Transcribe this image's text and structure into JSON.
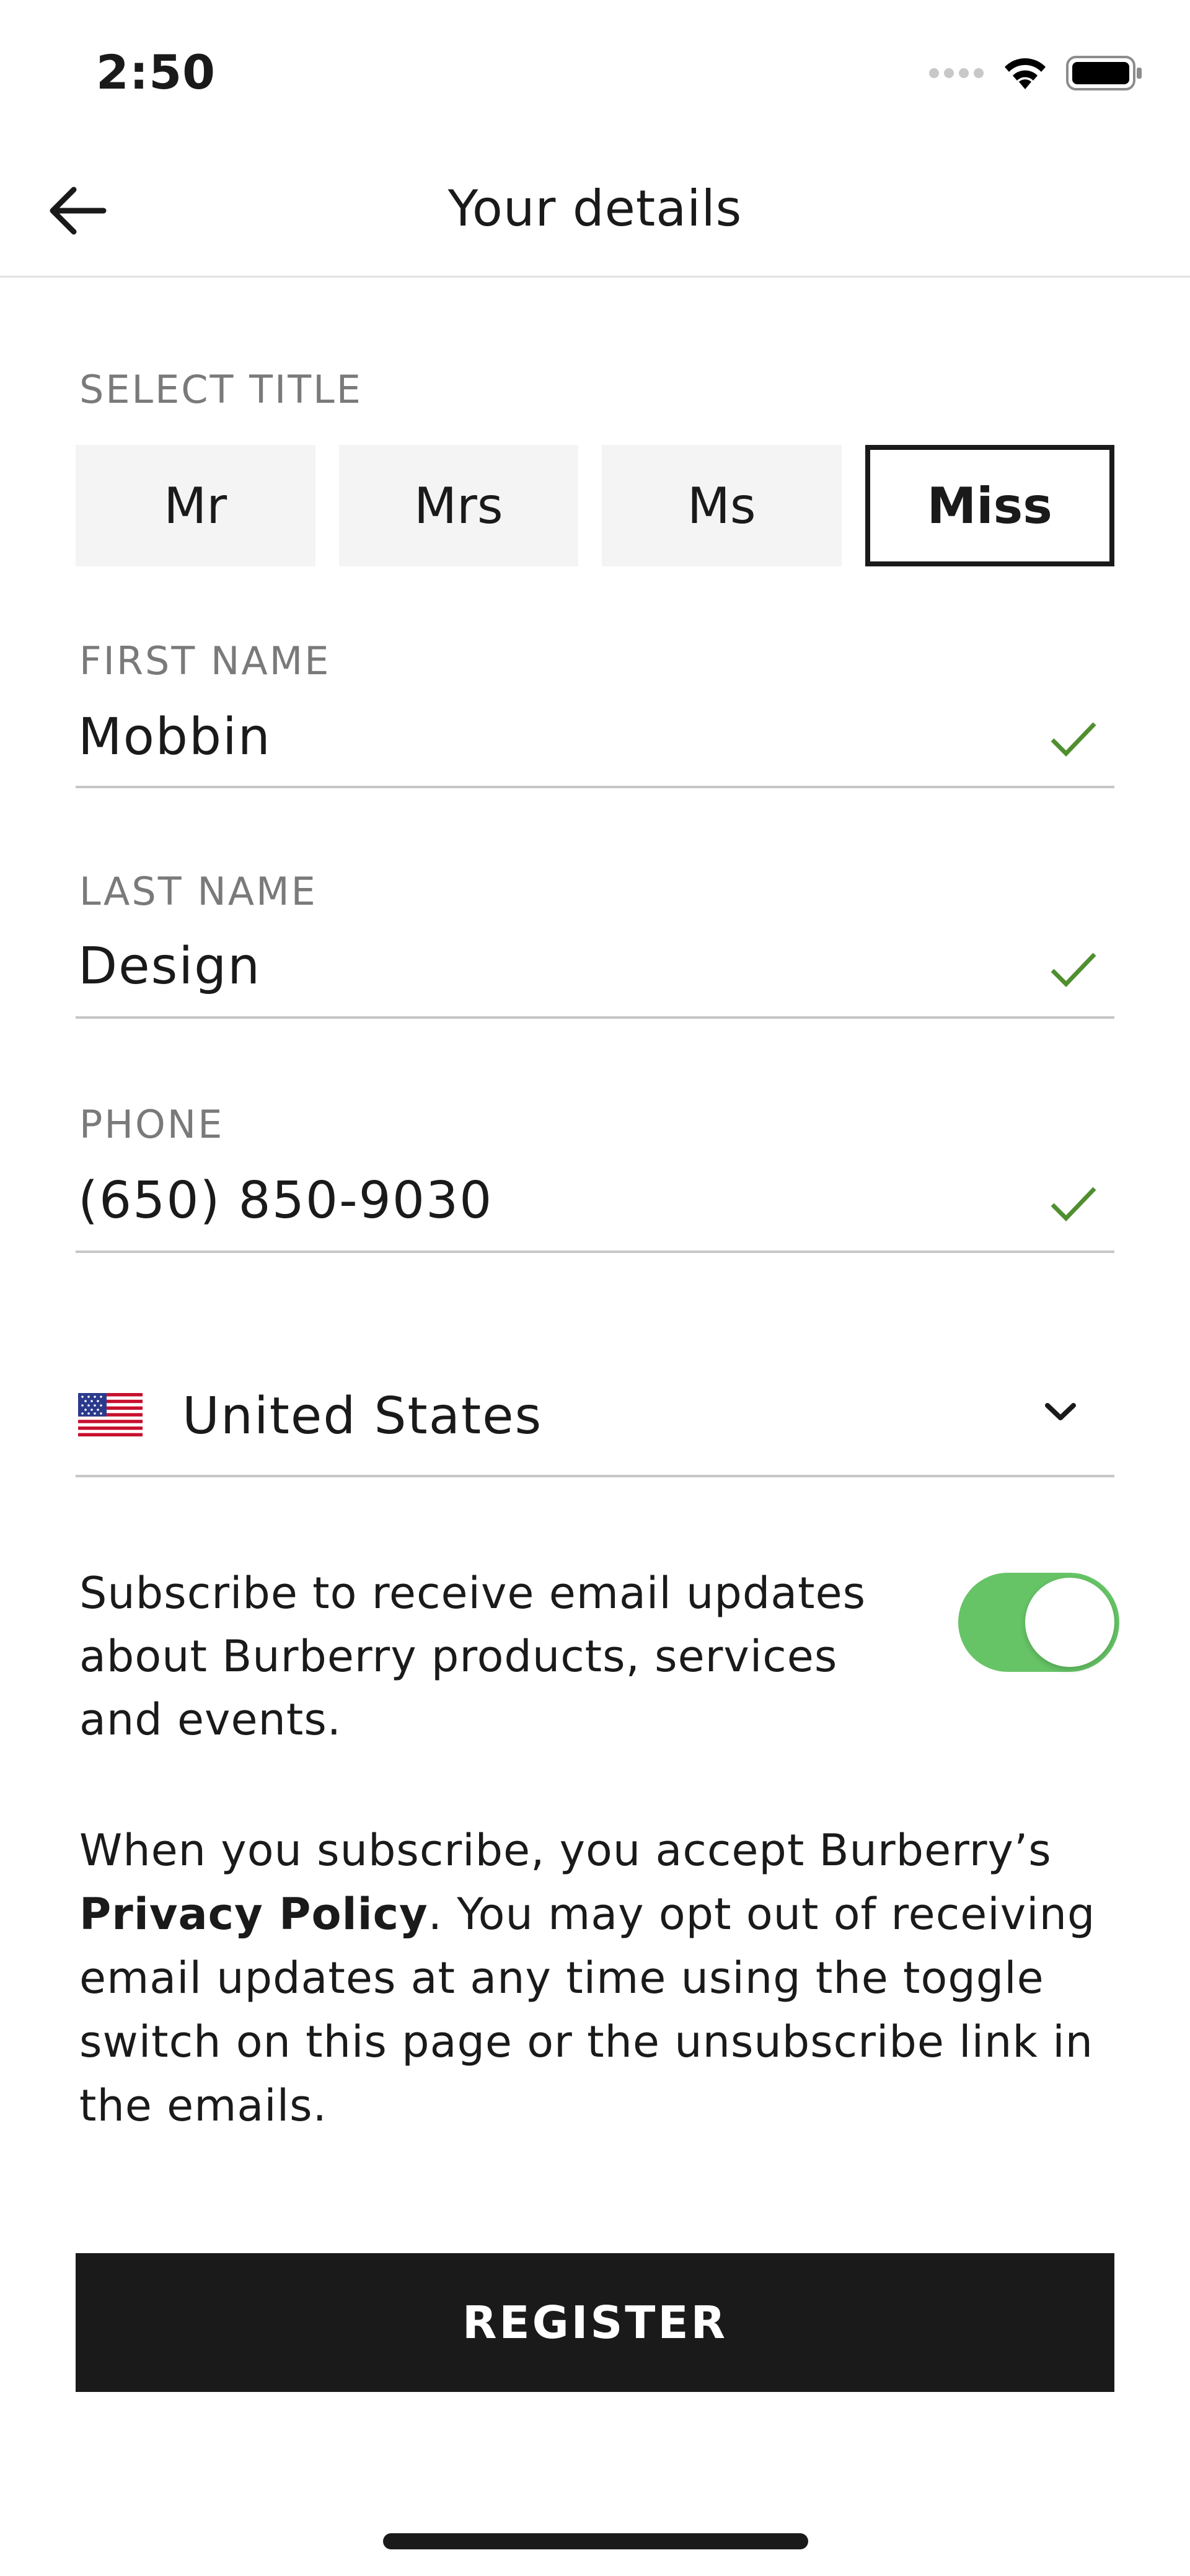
{
  "status_bar": {
    "time": "2:50"
  },
  "nav": {
    "title": "Your details"
  },
  "title_select": {
    "label": "SELECT TITLE",
    "options": [
      "Mr",
      "Mrs",
      "Ms",
      "Miss"
    ],
    "selected": "Miss"
  },
  "fields": {
    "first_name": {
      "label": "FIRST NAME",
      "value": "Mobbin"
    },
    "last_name": {
      "label": "LAST NAME",
      "value": "Design"
    },
    "phone": {
      "label": "PHONE",
      "value": "(650) 850-9030"
    }
  },
  "country": {
    "value": "United States"
  },
  "subscribe": {
    "text": "Subscribe to receive email updates about Burberry products, services and events.",
    "enabled": true
  },
  "policy": {
    "prefix": "When you subscribe, you accept Burberry’s ",
    "link": "Privacy Policy",
    "suffix": ". You may opt out of receiving email updates at any time using the toggle switch on this page or the unsubscribe link in the emails."
  },
  "register_label": "REGISTER",
  "colors": {
    "check": "#4f8f2f",
    "toggle_on": "#66c466",
    "primary": "#1a1a1a"
  }
}
